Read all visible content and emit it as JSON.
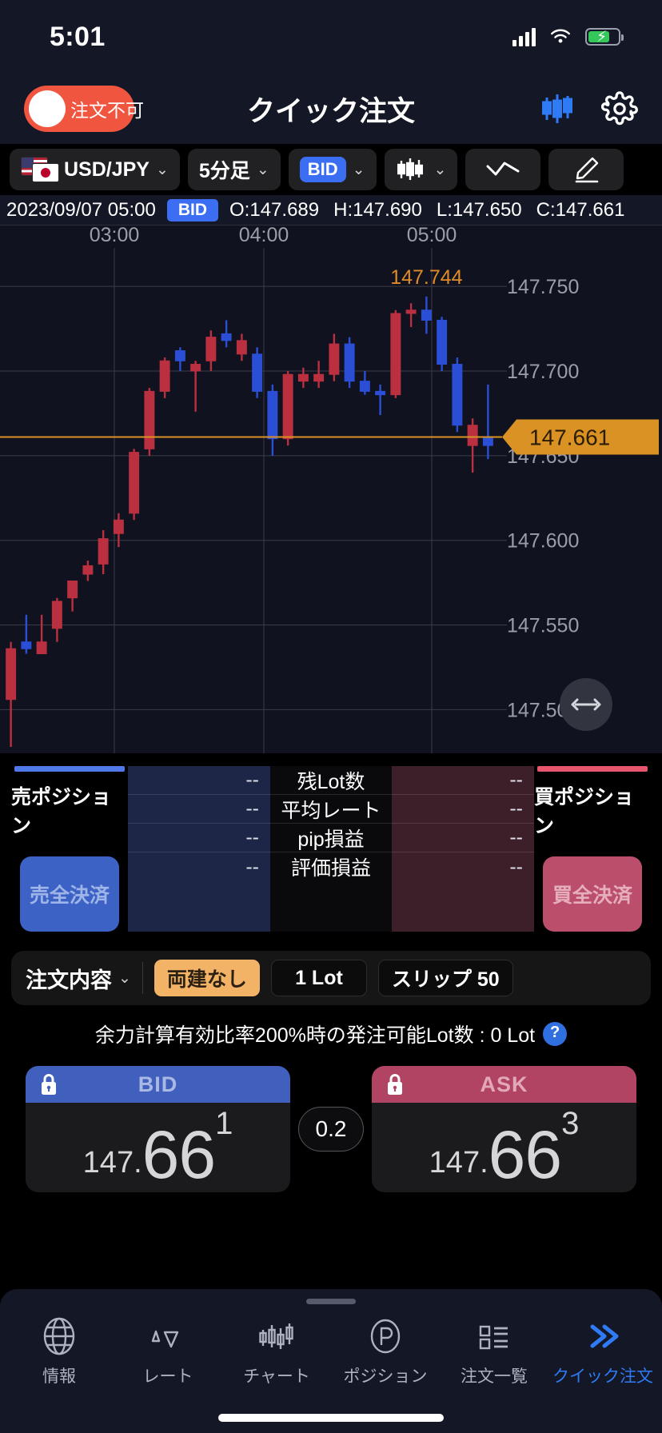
{
  "status_bar": {
    "time": "5:01",
    "signal_icon": "cellular-bars-icon",
    "wifi_icon": "wifi-icon",
    "battery_icon": "battery-charging-icon"
  },
  "header": {
    "toggle_label": "注文不可",
    "toggle_color": "#f0553f",
    "title": "クイック注文",
    "chart_icon": "candlestick-icon",
    "settings_icon": "gear-icon"
  },
  "toolbar": {
    "pair": "USD/JPY",
    "timeframe": "5分足",
    "rate_type": "BID",
    "indicator_icon": "candlestick-type-icon",
    "line_icon": "line-chart-icon",
    "draw_icon": "pen-icon",
    "accent": "#3b6ef2"
  },
  "ohlc": {
    "datetime": "2023/09/07 05:00",
    "type": "BID",
    "open": "O:147.689",
    "high": "H:147.690",
    "low": "L:147.650",
    "close": "C:147.661"
  },
  "chart_data": {
    "type": "candlestick",
    "title": "USD/JPY 5分足",
    "xlabel": "",
    "ylabel": "",
    "ylim": [
      147.478,
      147.768
    ],
    "yticks": [
      "147.750",
      "147.700",
      "147.650",
      "147.600",
      "147.550",
      "147.500"
    ],
    "ytick_values": [
      147.75,
      147.7,
      147.65,
      147.6,
      147.55,
      147.5
    ],
    "xticks": [
      "03:00",
      "04:00",
      "05:00"
    ],
    "xtick_x": [
      143,
      330,
      540
    ],
    "grid": true,
    "up_color": "#2a4fd6",
    "down_color": "#bb3040",
    "last_price": 147.661,
    "last_price_label": "147.661",
    "last_price_color": "#d99223",
    "high_annotation": "147.744",
    "high_annotation_color": "#e08a28",
    "candles": [
      {
        "o": 147.506,
        "h": 147.54,
        "l": 147.478,
        "c": 147.536,
        "dir": "down"
      },
      {
        "o": 147.536,
        "h": 147.556,
        "l": 147.533,
        "c": 147.54,
        "dir": "up"
      },
      {
        "o": 147.54,
        "h": 147.556,
        "l": 147.534,
        "c": 147.533,
        "dir": "down"
      },
      {
        "o": 147.548,
        "h": 147.566,
        "l": 147.54,
        "c": 147.564,
        "dir": "down"
      },
      {
        "o": 147.566,
        "h": 147.576,
        "l": 147.558,
        "c": 147.576,
        "dir": "down"
      },
      {
        "o": 147.58,
        "h": 147.588,
        "l": 147.576,
        "c": 147.585,
        "dir": "down"
      },
      {
        "o": 147.586,
        "h": 147.606,
        "l": 147.58,
        "c": 147.601,
        "dir": "down"
      },
      {
        "o": 147.604,
        "h": 147.616,
        "l": 147.596,
        "c": 147.612,
        "dir": "down"
      },
      {
        "o": 147.616,
        "h": 147.654,
        "l": 147.612,
        "c": 147.652,
        "dir": "down"
      },
      {
        "o": 147.654,
        "h": 147.69,
        "l": 147.65,
        "c": 147.688,
        "dir": "down"
      },
      {
        "o": 147.688,
        "h": 147.708,
        "l": 147.684,
        "c": 147.706,
        "dir": "down"
      },
      {
        "o": 147.706,
        "h": 147.714,
        "l": 147.7,
        "c": 147.712,
        "dir": "up"
      },
      {
        "o": 147.7,
        "h": 147.706,
        "l": 147.676,
        "c": 147.704,
        "dir": "down"
      },
      {
        "o": 147.706,
        "h": 147.724,
        "l": 147.7,
        "c": 147.72,
        "dir": "down"
      },
      {
        "o": 147.722,
        "h": 147.73,
        "l": 147.714,
        "c": 147.718,
        "dir": "up"
      },
      {
        "o": 147.718,
        "h": 147.722,
        "l": 147.706,
        "c": 147.71,
        "dir": "down"
      },
      {
        "o": 147.71,
        "h": 147.714,
        "l": 147.684,
        "c": 147.688,
        "dir": "up"
      },
      {
        "o": 147.688,
        "h": 147.692,
        "l": 147.65,
        "c": 147.66,
        "dir": "up"
      },
      {
        "o": 147.66,
        "h": 147.7,
        "l": 147.656,
        "c": 147.698,
        "dir": "down"
      },
      {
        "o": 147.698,
        "h": 147.702,
        "l": 147.69,
        "c": 147.694,
        "dir": "down"
      },
      {
        "o": 147.694,
        "h": 147.706,
        "l": 147.69,
        "c": 147.698,
        "dir": "down"
      },
      {
        "o": 147.698,
        "h": 147.722,
        "l": 147.694,
        "c": 147.716,
        "dir": "down"
      },
      {
        "o": 147.716,
        "h": 147.72,
        "l": 147.69,
        "c": 147.694,
        "dir": "up"
      },
      {
        "o": 147.694,
        "h": 147.7,
        "l": 147.686,
        "c": 147.688,
        "dir": "up"
      },
      {
        "o": 147.688,
        "h": 147.692,
        "l": 147.674,
        "c": 147.686,
        "dir": "up"
      },
      {
        "o": 147.686,
        "h": 147.736,
        "l": 147.684,
        "c": 147.734,
        "dir": "down"
      },
      {
        "o": 147.734,
        "h": 147.74,
        "l": 147.726,
        "c": 147.736,
        "dir": "down"
      },
      {
        "o": 147.736,
        "h": 147.744,
        "l": 147.722,
        "c": 147.73,
        "dir": "up"
      },
      {
        "o": 147.73,
        "h": 147.732,
        "l": 147.7,
        "c": 147.704,
        "dir": "up"
      },
      {
        "o": 147.704,
        "h": 147.708,
        "l": 147.664,
        "c": 147.668,
        "dir": "up"
      },
      {
        "o": 147.668,
        "h": 147.672,
        "l": 147.64,
        "c": 147.656,
        "dir": "down"
      },
      {
        "o": 147.656,
        "h": 147.692,
        "l": 147.648,
        "c": 147.661,
        "dir": "up"
      }
    ],
    "resize_icon": "horizontal-resize-icon"
  },
  "positions": {
    "sell_label": "売ポジション",
    "buy_label": "買ポジション",
    "sell_close_button": "売全決済",
    "buy_close_button": "買全決済",
    "rows": [
      {
        "metric": "残Lot数",
        "sell": "--",
        "buy": "--"
      },
      {
        "metric": "平均レート",
        "sell": "--",
        "buy": "--"
      },
      {
        "metric": "pip損益",
        "sell": "--",
        "buy": "--"
      },
      {
        "metric": "評価損益",
        "sell": "--",
        "buy": "--"
      }
    ]
  },
  "order_settings": {
    "title": "注文内容",
    "hedge": "両建なし",
    "lot": "1 Lot",
    "slip": "スリップ 50",
    "margin_note": "余力計算有効比率200%時の発注可能Lot数 : 0 Lot",
    "help_icon": "question-icon"
  },
  "deal": {
    "bid": {
      "label": "BID",
      "lock_icon": "lock-icon",
      "int_part": "147.",
      "main": "66",
      "pip": "1"
    },
    "ask": {
      "label": "ASK",
      "lock_icon": "lock-icon",
      "int_part": "147.",
      "main": "66",
      "pip": "3"
    },
    "spread": "0.2"
  },
  "bottom_nav": {
    "items": [
      {
        "label": "情報",
        "icon": "globe-icon",
        "active": false
      },
      {
        "label": "レート",
        "icon": "triangles-icon",
        "active": false
      },
      {
        "label": "チャート",
        "icon": "candlestick-icon",
        "active": false
      },
      {
        "label": "ポジション",
        "icon": "p-circle-icon",
        "active": false
      },
      {
        "label": "注文一覧",
        "icon": "list-icon",
        "active": false
      },
      {
        "label": "クイック注文",
        "icon": "double-chevron-icon",
        "active": true
      }
    ],
    "active_color": "#2f7bf6"
  }
}
